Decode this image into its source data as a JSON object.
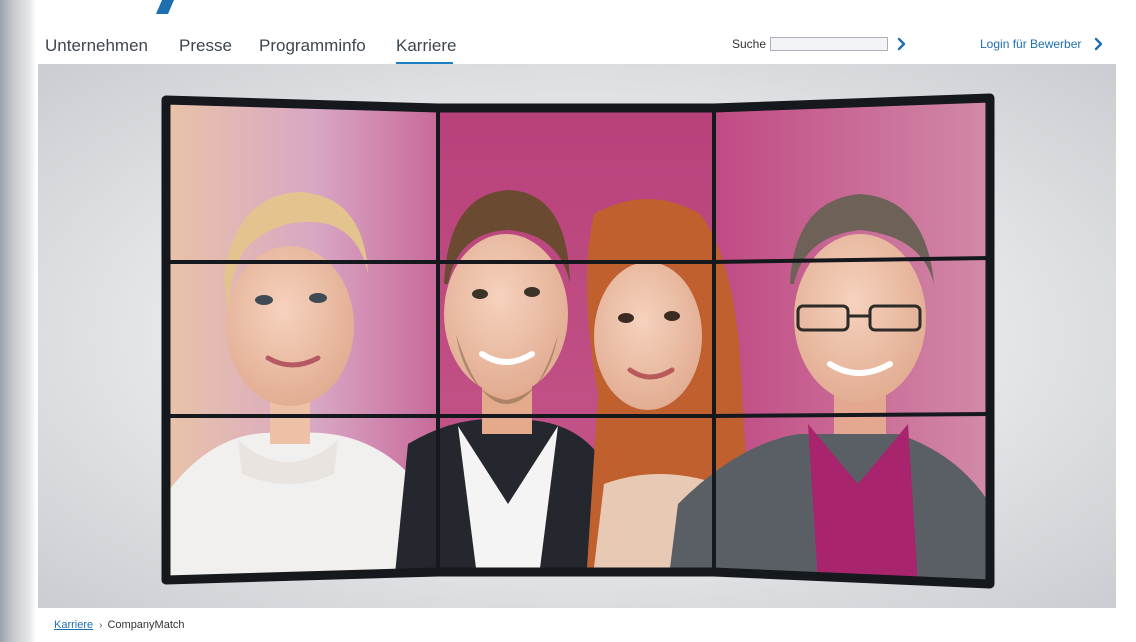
{
  "nav": {
    "items": [
      {
        "label": "Unternehmen"
      },
      {
        "label": "Presse"
      },
      {
        "label": "Programminfo"
      },
      {
        "label": "Karriere",
        "active": true
      }
    ]
  },
  "search": {
    "label": "Suche",
    "value": "",
    "submit_icon": "chevron-right-icon"
  },
  "login": {
    "label": "Login für Bewerber",
    "icon": "chevron-right-icon"
  },
  "hero": {
    "description_icon": "video-wall-photo",
    "grid_rows": 3,
    "grid_cols": 3
  },
  "breadcrumb": {
    "parent": "Karriere",
    "current": "CompanyMatch"
  },
  "colors": {
    "accent": "#1e7fc4",
    "link": "#1e6fb0",
    "nav_text": "#3d4650",
    "screen_pink": "#c24a86",
    "frame_black": "#15181c"
  }
}
